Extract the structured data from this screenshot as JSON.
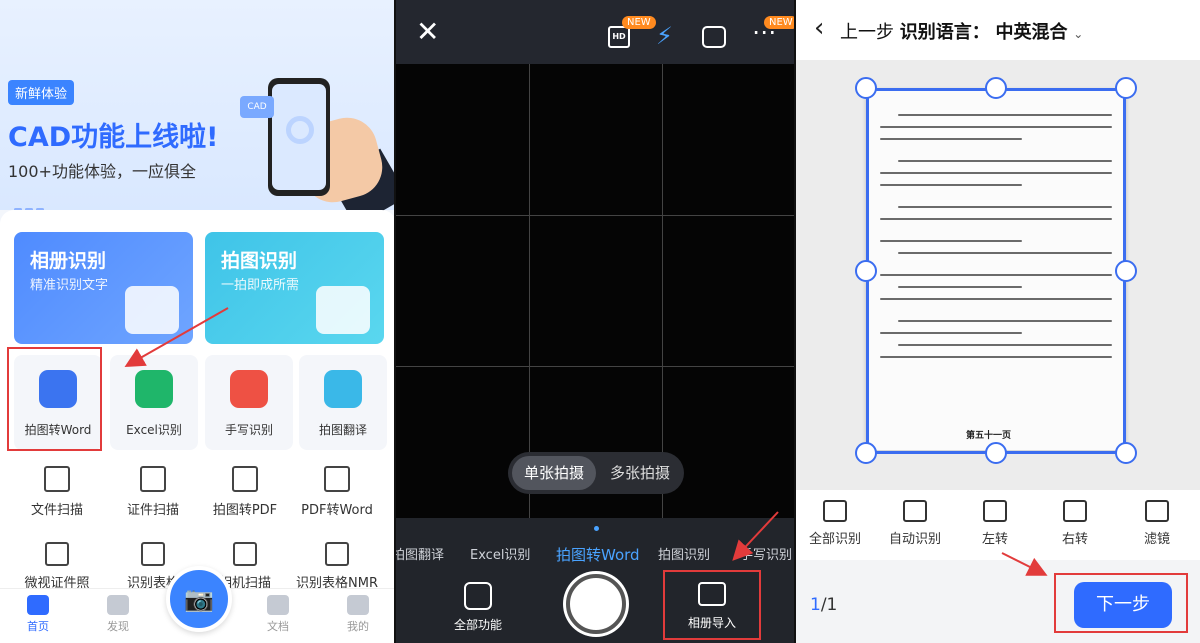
{
  "panel1": {
    "banner": {
      "tag": "新鲜体验",
      "title": "CAD功能上线啦!",
      "subtitle": "100+功能体验，一应俱全",
      "chip": "CAD"
    },
    "cards": [
      {
        "title": "相册识别",
        "subtitle": "精准识别文字"
      },
      {
        "title": "拍图识别",
        "subtitle": "一拍即成所需"
      }
    ],
    "tiles": [
      {
        "label": "拍图转Word",
        "color": "#3b74f0"
      },
      {
        "label": "Excel识别",
        "color": "#1fb66a"
      },
      {
        "label": "手写识别",
        "color": "#ee5144"
      },
      {
        "label": "拍图翻译",
        "color": "#3ab8e8"
      }
    ],
    "row2": [
      "文件扫描",
      "证件扫描",
      "拍图转PDF",
      "PDF转Word"
    ],
    "row3": [
      "微视证件照",
      "识别表格",
      "相机扫描",
      "识别表格NMR"
    ],
    "tabs": [
      {
        "label": "首页",
        "icon": "home-icon"
      },
      {
        "label": "发现",
        "icon": "cube-icon"
      },
      {
        "label": "文档",
        "icon": "document-icon"
      },
      {
        "label": "我的",
        "icon": "user-icon"
      }
    ]
  },
  "panel2": {
    "badge_new": "NEW",
    "hd": "HD",
    "modes": [
      "单张拍摄",
      "多张拍摄"
    ],
    "carousel": [
      "拍图翻译",
      "Excel识别",
      "拍图转Word",
      "拍图识别",
      "手写识别"
    ],
    "all_functions": "全部功能",
    "album_import": "相册导入"
  },
  "panel3": {
    "back": "上一步",
    "title_label": "识别语言：",
    "title_value": "中英混合",
    "tools": [
      "全部识别",
      "自动识别",
      "左转",
      "右转",
      "滤镜"
    ],
    "page_current": "1",
    "page_total": "/1",
    "next": "下一步",
    "doc_footer": "第五十一页"
  },
  "colors": {
    "brand_blue": "#2f6bff",
    "highlight_red": "#e23b3b",
    "camera_bar": "#24272f"
  }
}
